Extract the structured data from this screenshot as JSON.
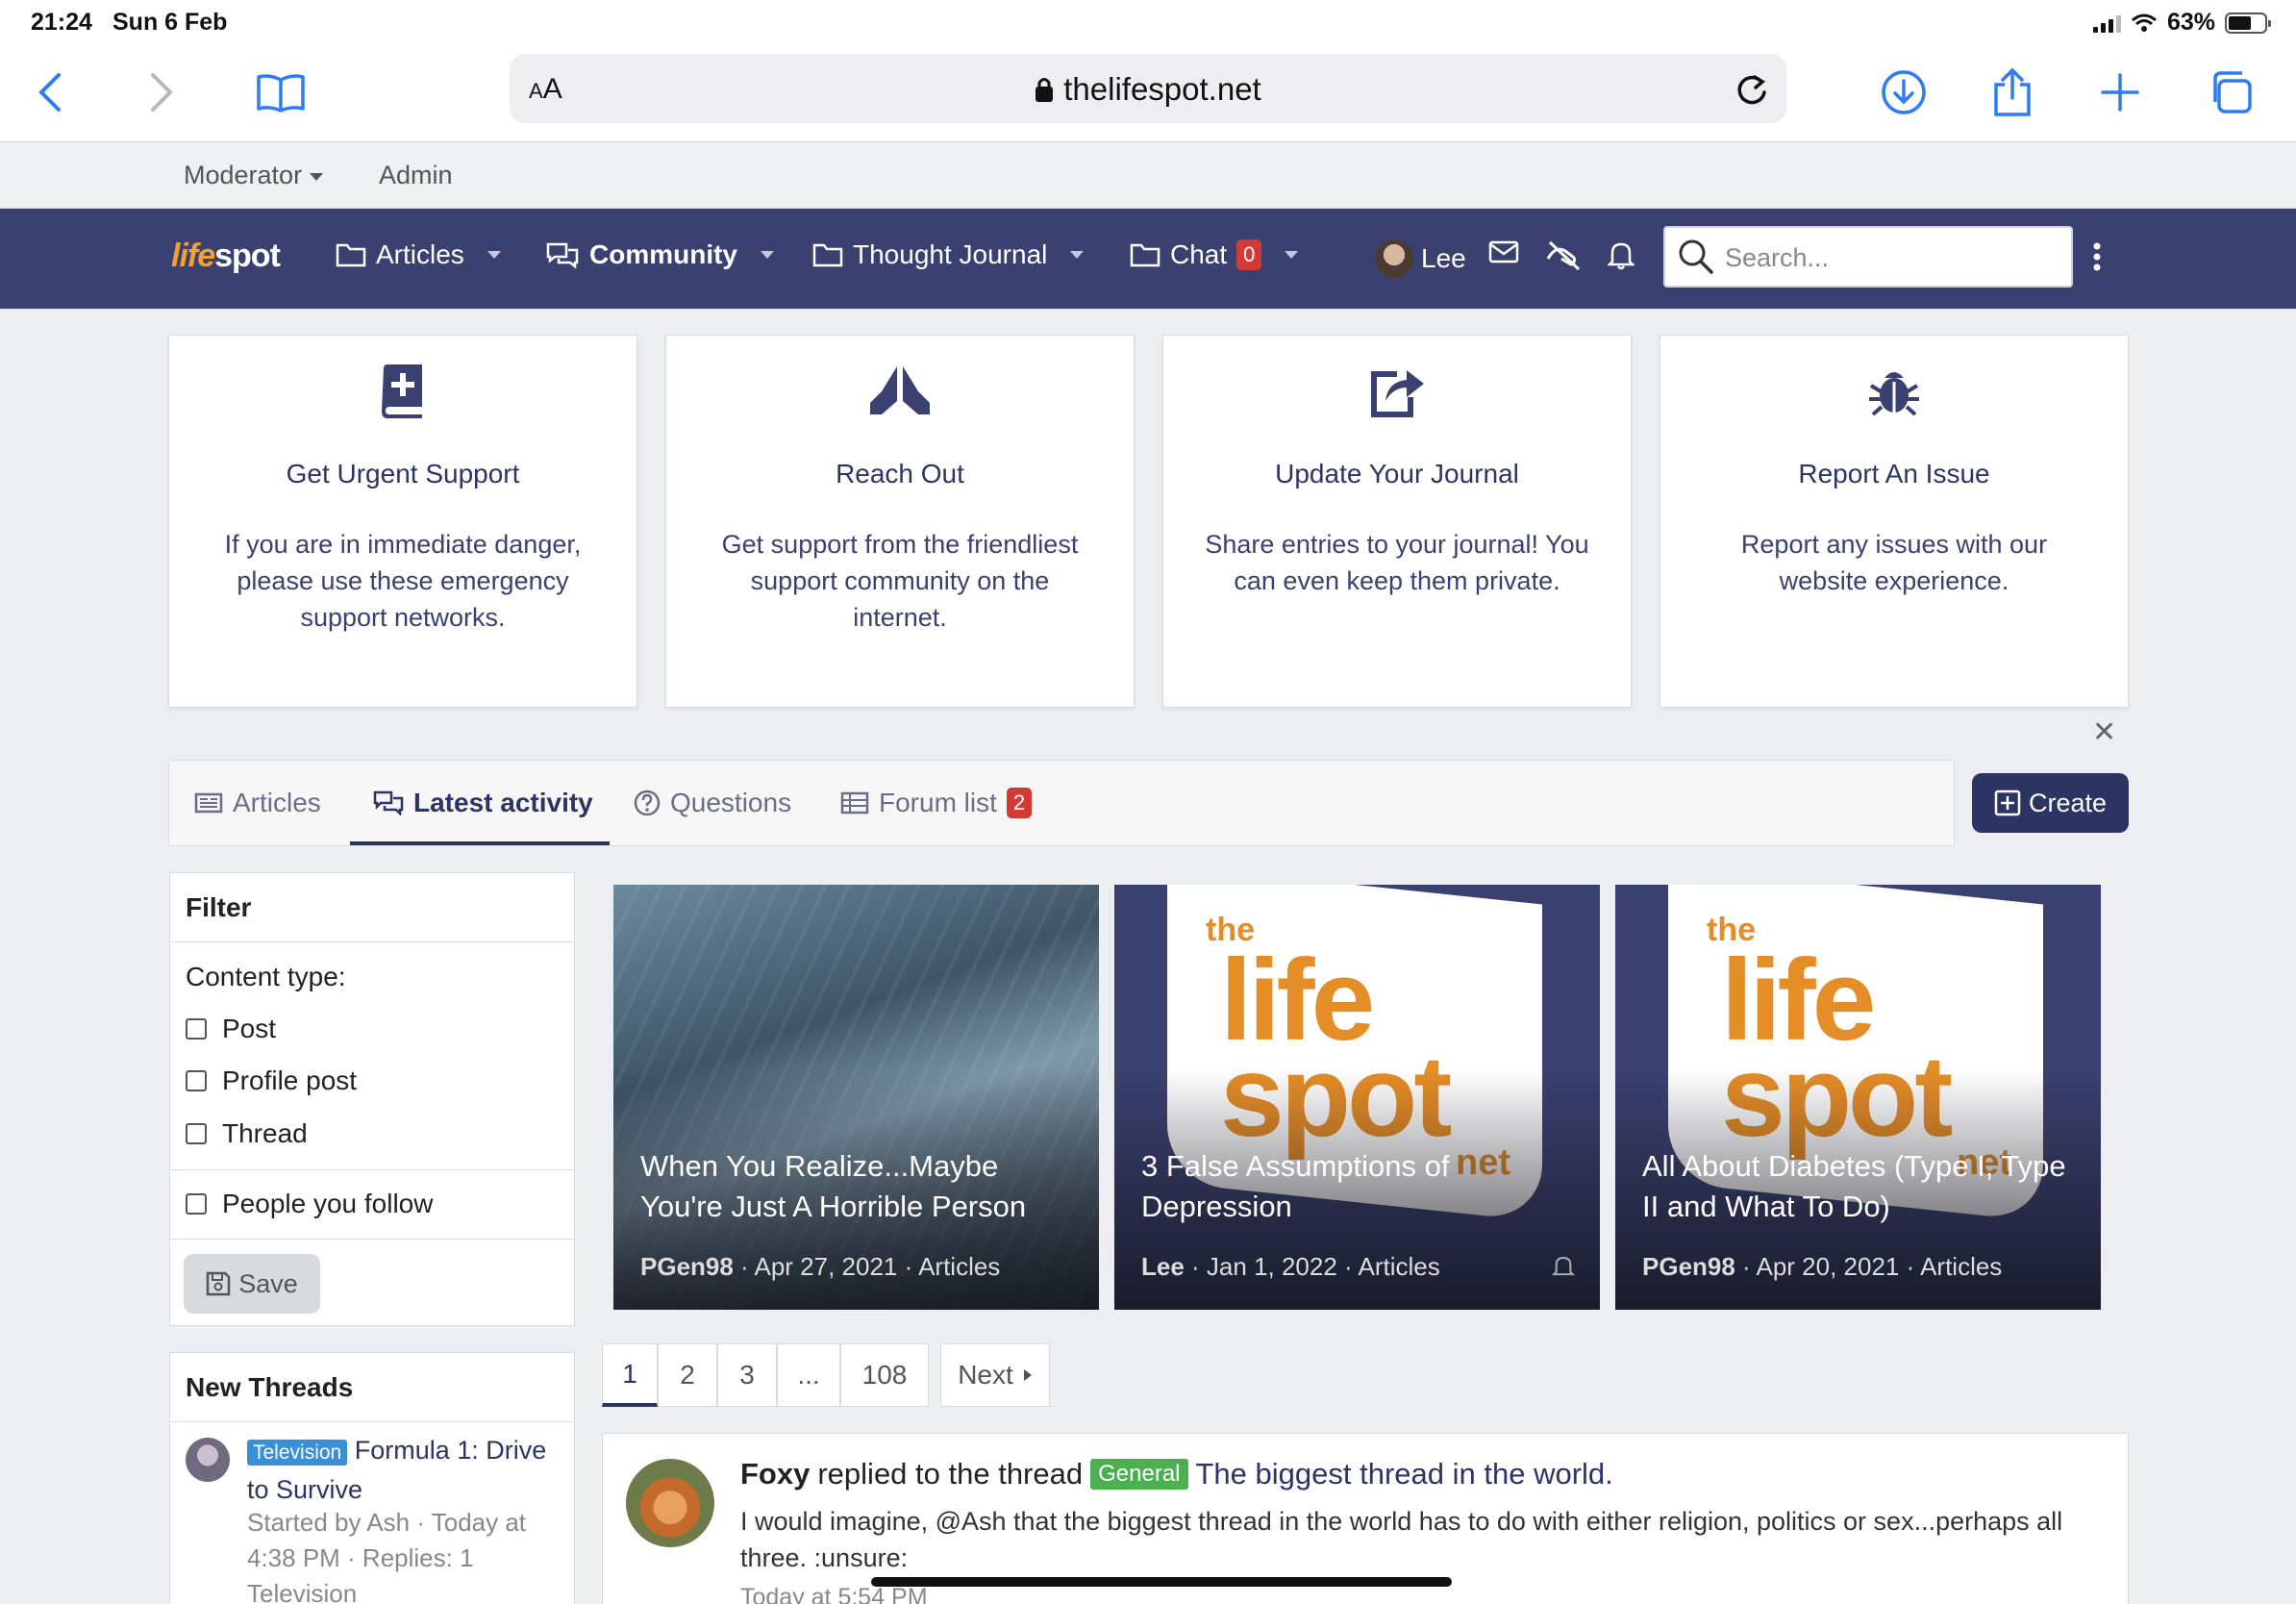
{
  "status": {
    "time": "21:24",
    "date": "Sun 6 Feb",
    "battery": "63%"
  },
  "browser": {
    "aa": "A",
    "aa_big": "A",
    "domain": "thelifespot.net"
  },
  "modbar": {
    "moderator": "Moderator",
    "admin": "Admin"
  },
  "nav": {
    "logo_a": "life",
    "logo_b": "spot",
    "items": [
      {
        "label": "Articles"
      },
      {
        "label": "Community"
      },
      {
        "label": "Thought Journal"
      },
      {
        "label": "Chat",
        "badge": "0"
      }
    ],
    "user": "Lee",
    "search_placeholder": "Search..."
  },
  "cards": [
    {
      "title": "Get Urgent Support",
      "text": "If you are in immediate danger, please use these emergency support networks.",
      "icon": "book-plus-icon"
    },
    {
      "title": "Reach Out",
      "text": "Get support from the friendliest support community on the internet.",
      "icon": "praying-hands-icon"
    },
    {
      "title": "Update Your Journal",
      "text": "Share entries to your journal! You can even keep them private.",
      "icon": "share-square-icon"
    },
    {
      "title": "Report An Issue",
      "text": "Report any issues with our website experience.",
      "icon": "bug-icon"
    }
  ],
  "tabs": {
    "items": [
      {
        "label": "Articles"
      },
      {
        "label": "Latest activity"
      },
      {
        "label": "Questions"
      },
      {
        "label": "Forum list",
        "badge": "2"
      }
    ],
    "create": "Create"
  },
  "filter": {
    "title": "Filter",
    "content_type": "Content type:",
    "options": [
      "Post",
      "Profile post",
      "Thread"
    ],
    "follow": "People you follow",
    "save": "Save"
  },
  "tiles": [
    {
      "title": "When You Realize...Maybe You're Just A Horrible Person",
      "author": "PGen98",
      "date": "Apr 27, 2021",
      "section": "Articles"
    },
    {
      "title": "3 False Assumptions of Depression",
      "author": "Lee",
      "date": "Jan 1, 2022",
      "section": "Articles"
    },
    {
      "title": "All About Diabetes (Type I, Type II and What To Do)",
      "author": "PGen98",
      "date": "Apr 20, 2021",
      "section": "Articles"
    }
  ],
  "brand": {
    "the": "the",
    "life": "life",
    "spot": "spot",
    "net": "net"
  },
  "pagination": {
    "pages": [
      "1",
      "2",
      "3",
      "...",
      "108"
    ],
    "next": "Next"
  },
  "new_threads": {
    "title": "New Threads",
    "tag": "Television",
    "thread": "Formula 1: Drive to Survive",
    "meta": "Started by Ash · Today at 4:38 PM · Replies: 1",
    "forum": "Television"
  },
  "activity": {
    "user": "Foxy",
    "action": "replied to the thread",
    "tag": "General",
    "thread": "The biggest thread in the world.",
    "body": "I would imagine, @Ash that the biggest thread in the world has to do with either religion, politics or sex...perhaps all three. :unsure:",
    "when": "Today at 5:54 PM"
  }
}
